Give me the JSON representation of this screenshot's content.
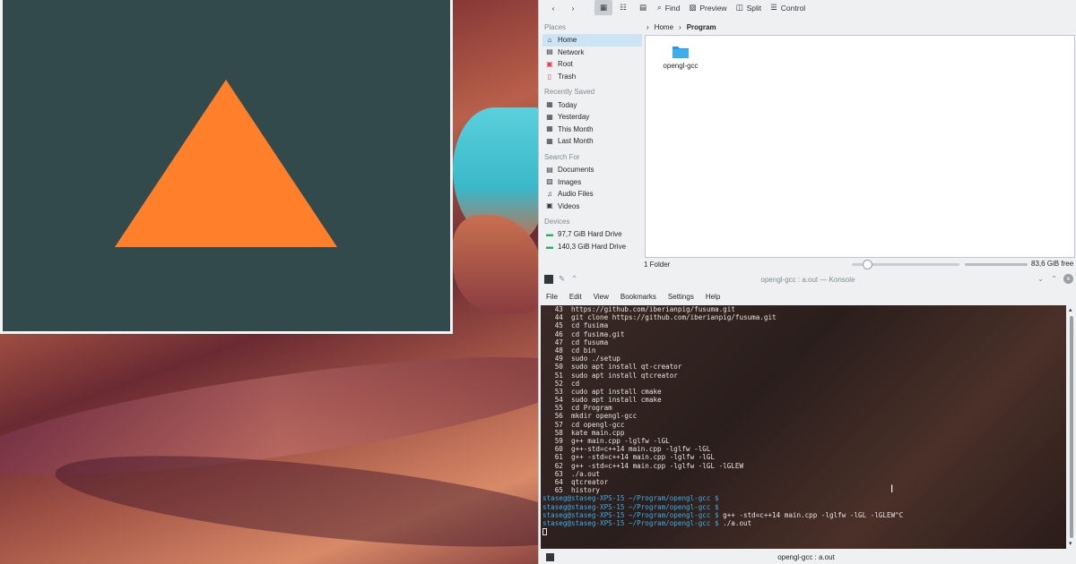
{
  "gl_window": {
    "background": "#324a4b",
    "triangle_color": "#ff7f2a"
  },
  "dolphin": {
    "toolbar": {
      "buttons": [
        {
          "icon": "chevron-left-icon"
        },
        {
          "icon": "chevron-right-icon"
        },
        {
          "icon": "icons-view-icon",
          "active": true
        },
        {
          "icon": "compact-view-icon"
        },
        {
          "icon": "details-view-icon"
        }
      ],
      "find": "Find",
      "preview": "Preview",
      "split": "Split",
      "control": "Control"
    },
    "places": {
      "places_header": "Places",
      "places_items": [
        "Home",
        "Network",
        "Root",
        "Trash"
      ],
      "recent_header": "Recently Saved",
      "recent_items": [
        "Today",
        "Yesterday",
        "This Month",
        "Last Month"
      ],
      "search_header": "Search For",
      "search_items": [
        "Documents",
        "Images",
        "Audio Files",
        "Videos"
      ],
      "devices_header": "Devices",
      "devices_items": [
        "97,7 GiB Hard Drive",
        "140,3 GiB Hard Drive"
      ]
    },
    "breadcrumb": {
      "home": "Home",
      "current": "Program"
    },
    "folder": {
      "name": "opengl-gcc"
    },
    "status": {
      "count": "1 Folder",
      "free": "83,6 GiB free"
    }
  },
  "konsole": {
    "title": "opengl-gcc : a.out — Konsole",
    "menu": [
      "File",
      "Edit",
      "View",
      "Bookmarks",
      "Settings",
      "Help"
    ],
    "history": [
      "   43  https://github.com/iberianpig/fusuma.git",
      "   44  git clone https://github.com/iberianpig/fusuma.git",
      "   45  cd fusima",
      "   46  cd fusima.git",
      "   47  cd fusuma",
      "   48  cd bin",
      "   49  sudo ./setup",
      "   50  sudo apt install qt-creator",
      "   51  sudo apt install qtcreator",
      "   52  cd",
      "   53  cudo apt install cmake",
      "   54  sudo apt install cmake",
      "   55  cd Program",
      "   56  mkdir opengl-gcc",
      "   57  cd opengl-gcc",
      "   58  kate main.cpp",
      "   59  g++ main.cpp -lglfw -lGL",
      "   60  g++-std=c++14 main.cpp -lglfw -lGL",
      "   61  g++ -std=c++14 main.cpp -lglfw -lGL",
      "   62  g++ -std=c++14 main.cpp -lglfw -lGL -lGLEW",
      "   63  ./a.out",
      "   64  qtcreator",
      "   65  history"
    ],
    "prompt": "staseg@staseg-XPS-15 ~/Program/opengl-gcc $",
    "prompt_lines": [
      "",
      "",
      " g++ -std=c++14 main.cpp -lglfw -lGL -lGLEW^C",
      " ./a.out"
    ],
    "tab_title": "opengl-gcc : a.out"
  }
}
